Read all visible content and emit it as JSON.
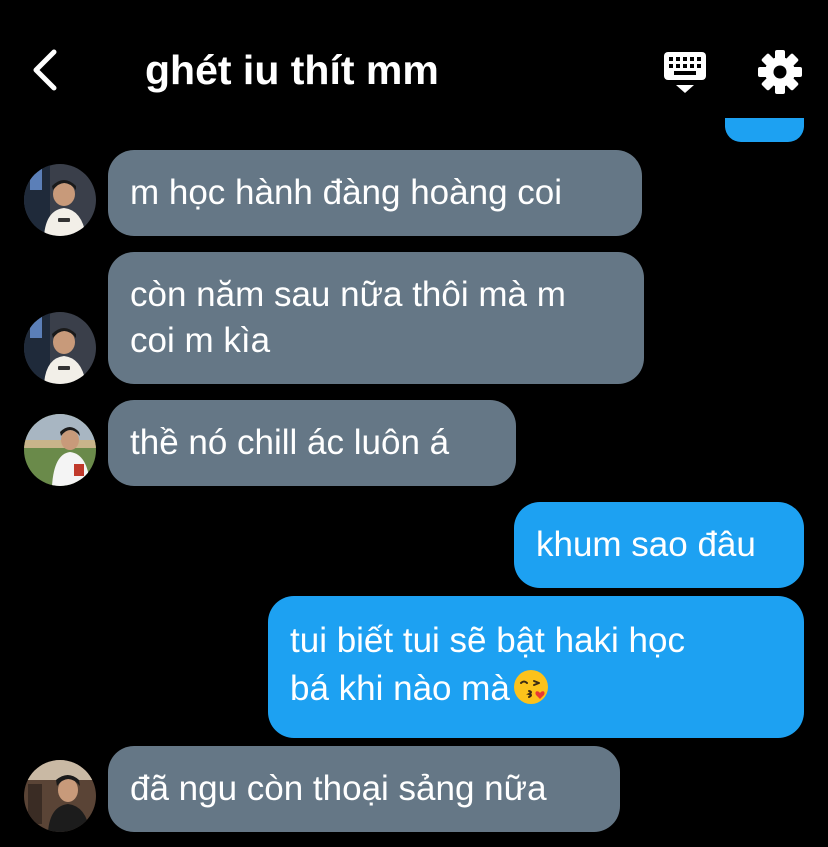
{
  "header": {
    "title": "ghét iu thít mm"
  },
  "colors": {
    "background": "#000000",
    "incoming_bubble": "#657786",
    "outgoing_bubble": "#1da1f2",
    "text": "#ffffff"
  },
  "icons": {
    "back": "chevron-left-icon",
    "keyboard": "keyboard-icon",
    "settings": "gear-icon",
    "emoji": "face-blowing-kiss-emoji"
  },
  "messages": [
    {
      "direction": "incoming",
      "lines": [
        "m học hành đàng hoàng coi"
      ]
    },
    {
      "direction": "incoming",
      "lines": [
        "còn năm sau nữa thôi mà m",
        "coi m kìa"
      ]
    },
    {
      "direction": "incoming",
      "lines": [
        "thề nó chill ác luôn á"
      ]
    },
    {
      "direction": "outgoing",
      "lines": [
        "khum sao đâu"
      ]
    },
    {
      "direction": "outgoing",
      "lines": [
        "tui biết tui sẽ bật haki học",
        "bá khi nào mà"
      ]
    },
    {
      "direction": "incoming",
      "lines": [
        "đã ngu còn thoại sảng nữa"
      ]
    }
  ]
}
